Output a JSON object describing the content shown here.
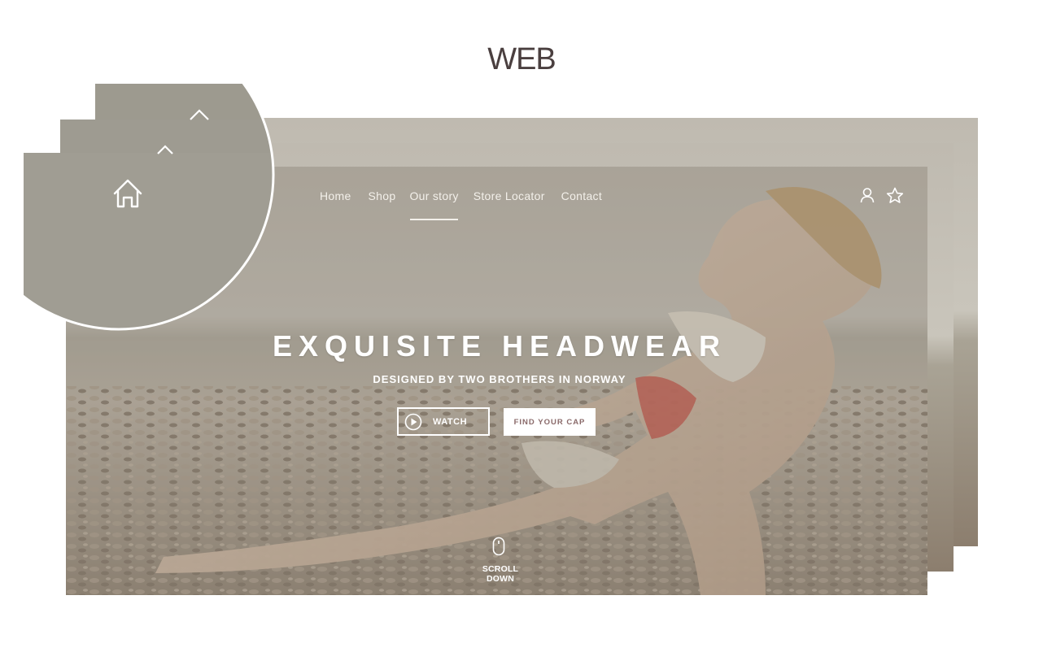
{
  "page_label": "WEB",
  "nav": {
    "items": [
      {
        "label": "Home",
        "active": false
      },
      {
        "label": "Shop",
        "active": false
      },
      {
        "label": "Our story",
        "active": true
      },
      {
        "label": "Store Locator",
        "active": false
      },
      {
        "label": "Contact",
        "active": false
      }
    ]
  },
  "hero": {
    "title": "EXQUISITE HEADWEAR",
    "subtitle": "DESIGNED BY TWO BROTHERS IN NORWAY",
    "watch_label": "WATCH",
    "find_label": "FIND YOUR CAP",
    "scroll_label": "SCROLL DOWN"
  },
  "icons": {
    "home": "home-icon",
    "user": "user-icon",
    "star": "star-icon",
    "play": "play-icon",
    "mouse": "mouse-icon",
    "chevron": "chevron-up-icon"
  },
  "colors": {
    "overlay": "#9e9a8c",
    "sky": "#c7c3b8",
    "sand": "#8c7f70",
    "title_text": "#4a3f3f",
    "button_text": "#8a6a6a"
  }
}
